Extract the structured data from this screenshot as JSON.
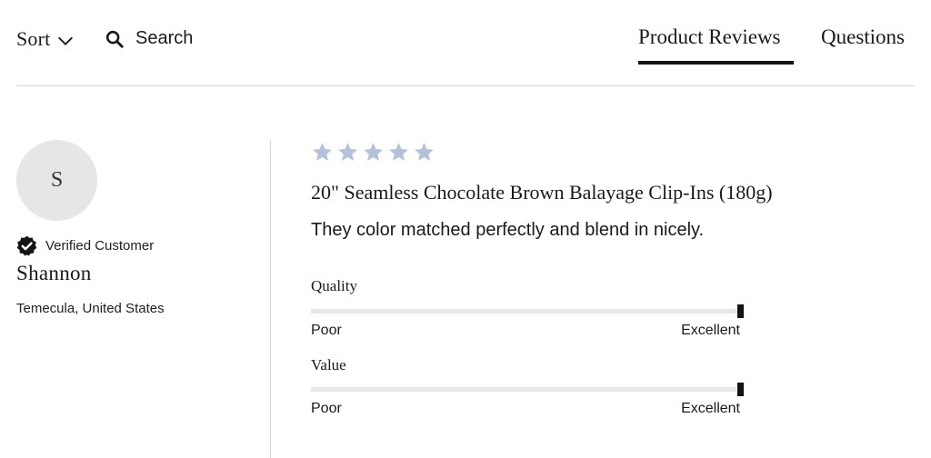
{
  "toolbar": {
    "sort_label": "Sort",
    "search_label": "Search"
  },
  "tabs": [
    {
      "label": "Product Reviews",
      "active": true
    },
    {
      "label": "Questions",
      "active": false
    }
  ],
  "reviewer": {
    "initial": "S",
    "verified_label": "Verified Customer",
    "name": "Shannon",
    "location": "Temecula, United States"
  },
  "review": {
    "rating": 5,
    "rating_max": 5,
    "product": "20\" Seamless Chocolate Brown Balayage Clip-Ins (180g)",
    "text": "They color matched perfectly and blend in nicely.",
    "metrics": [
      {
        "label": "Quality",
        "min_label": "Poor",
        "max_label": "Excellent",
        "value": 1.0
      },
      {
        "label": "Value",
        "min_label": "Poor",
        "max_label": "Excellent",
        "value": 1.0
      }
    ]
  },
  "colors": {
    "accent": "#141414",
    "star": "#b3c2d9",
    "avatar_bg": "#e6e6e6",
    "divider": "#d6d6d6"
  },
  "icons": {
    "sort": "chevron-down-icon",
    "search": "search-icon",
    "verified": "verified-badge-icon",
    "rating": "star-icon"
  }
}
